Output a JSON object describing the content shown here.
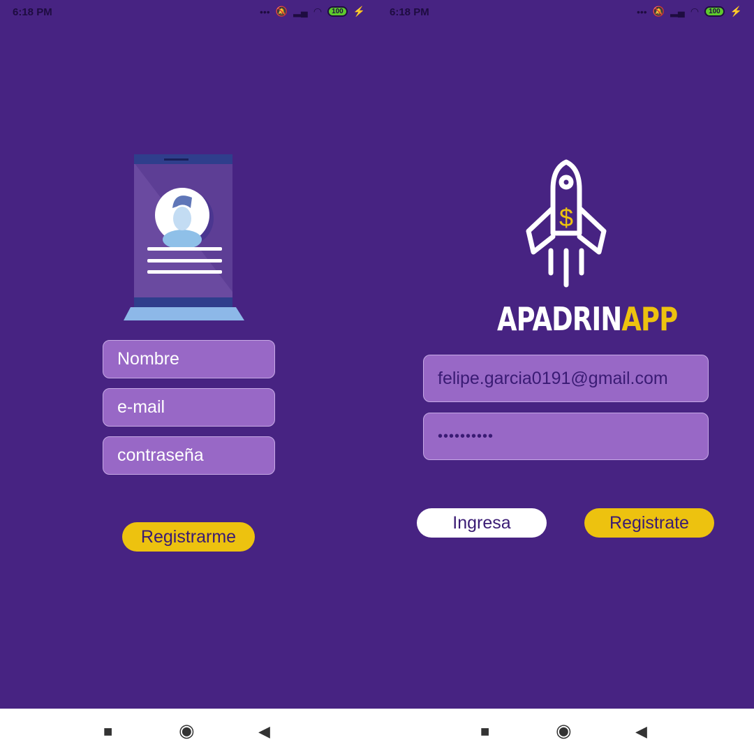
{
  "left": {
    "status": {
      "time": "6:18 PM",
      "battery": "100"
    },
    "fields": [
      {
        "placeholder": "Nombre"
      },
      {
        "placeholder": "e-mail"
      },
      {
        "placeholder": "contraseña"
      }
    ],
    "register_button": "Registrarme"
  },
  "right": {
    "status": {
      "time": "6:18 PM",
      "battery": "100"
    },
    "logo": {
      "part1": "APADRIN",
      "part2": "APP"
    },
    "email_value": "felipe.garcia0191@gmail.com",
    "password_value": "••••••••••",
    "login_button": "Ingresa",
    "register_button": "Registrate"
  },
  "colors": {
    "background": "#472382",
    "accent": "#edc20f",
    "field": "#9868c6"
  }
}
